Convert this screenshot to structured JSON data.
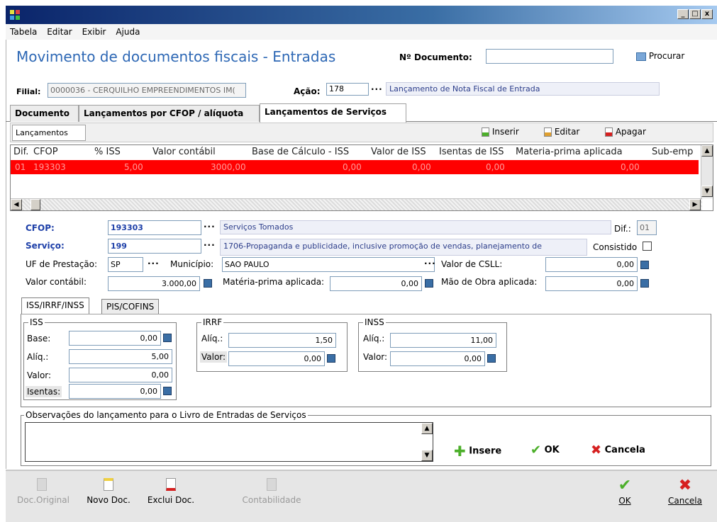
{
  "window": {
    "minimize": "_",
    "maximize": "□",
    "close": "x"
  },
  "menu": [
    "Tabela",
    "Editar",
    "Exibir",
    "Ajuda"
  ],
  "header": {
    "title": "Movimento de documentos fiscais - Entradas",
    "doc_label": "Nº Documento:",
    "doc_value": "",
    "search_label": "Procurar"
  },
  "filial": {
    "label": "Filial:",
    "value": "0000036 - CERQUILHO EMPREENDIMENTOS IM(",
    "acao_label": "Ação:",
    "acao_value": "178",
    "acao_desc": "Lançamento de Nota Fiscal de Entrada"
  },
  "tabs": [
    "Documento",
    "Lançamentos por CFOP / alíquota",
    "Lançamentos de Serviços"
  ],
  "subtab": "Lançamentos",
  "toolbar": {
    "insert": "Inserir",
    "edit": "Editar",
    "delete": "Apagar"
  },
  "grid": {
    "columns": [
      "Dif.",
      "CFOP",
      "% ISS",
      "Valor contábil",
      "Base de Cálculo - ISS",
      "Valor de ISS",
      "Isentas de ISS",
      "Materia-prima aplicada",
      "Sub-emp"
    ],
    "row": [
      "01",
      "193303",
      "5,00",
      "3000,00",
      "0,00",
      "0,00",
      "0,00",
      "0,00"
    ]
  },
  "form": {
    "cfop_label": "CFOP:",
    "cfop_value": "193303",
    "cfop_desc": "Serviços Tomados",
    "dif_label": "Dif.:",
    "dif_value": "01",
    "servico_label": "Serviço:",
    "servico_value": "199",
    "servico_desc": "1706-Propaganda e publicidade, inclusive promoção de vendas, planejamento de",
    "consistido_label": "Consistido",
    "uf_label": "UF de Prestação:",
    "uf_value": "SP",
    "municipio_label": "Município:",
    "municipio_value": "SAO PAULO",
    "csll_label": "Valor de CSLL:",
    "csll_value": "0,00",
    "valor_contabil_label": "Valor contábil:",
    "valor_contabil_value": "3.000,00",
    "materia_label": "Matéria-prima aplicada:",
    "materia_value": "0,00",
    "mao_label": "Mão de Obra aplicada:",
    "mao_value": "0,00"
  },
  "inner_tabs": [
    "ISS/IRRF/INSS",
    "PIS/COFINS"
  ],
  "iss": {
    "title": "ISS",
    "base_label": "Base:",
    "base_value": "0,00",
    "aliq_label": "Alíq.:",
    "aliq_value": "5,00",
    "valor_label": "Valor:",
    "valor_value": "0,00",
    "isentas_label": "Isentas:",
    "isentas_value": "0,00"
  },
  "irrf": {
    "title": "IRRF",
    "aliq_label": "Alíq.:",
    "aliq_value": "1,50",
    "valor_label": "Valor:",
    "valor_value": "0,00"
  },
  "inss": {
    "title": "INSS",
    "aliq_label": "Alíq.:",
    "aliq_value": "11,00",
    "valor_label": "Valor:",
    "valor_value": "0,00"
  },
  "obs": {
    "title": "Observações do lançamento para o Livro de Entradas de Serviços",
    "value": "",
    "insere": "Insere",
    "ok": "OK",
    "cancela": "Cancela"
  },
  "bottom": {
    "doc_original": "Doc.Original",
    "novo_doc": "Novo Doc.",
    "exclui_doc": "Exclui Doc.",
    "contabilidade": "Contabilidade",
    "ok": "OK",
    "cancela": "Cancela"
  },
  "colors": {
    "title_blue": "#2e68b5",
    "row_red": "#ff0000",
    "label_blue": "#1d3fa8",
    "ok_green": "#4caf2a",
    "cancel_red": "#d62020"
  }
}
